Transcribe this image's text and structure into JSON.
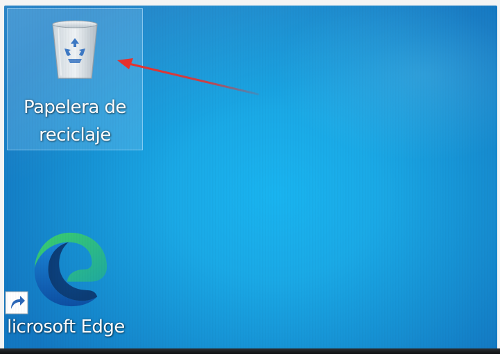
{
  "desktop": {
    "icons": [
      {
        "label": "Papelera de\nreciclaje",
        "icon": "recycle-bin-icon",
        "selected": true
      },
      {
        "label": "licrosoft Edge",
        "icon": "microsoft-edge-icon",
        "shortcut": true
      }
    ]
  },
  "colors": {
    "wallpaper": "#1aa9e6",
    "selection": "#8ccdf5",
    "annotation_arrow": "#e8302c"
  }
}
